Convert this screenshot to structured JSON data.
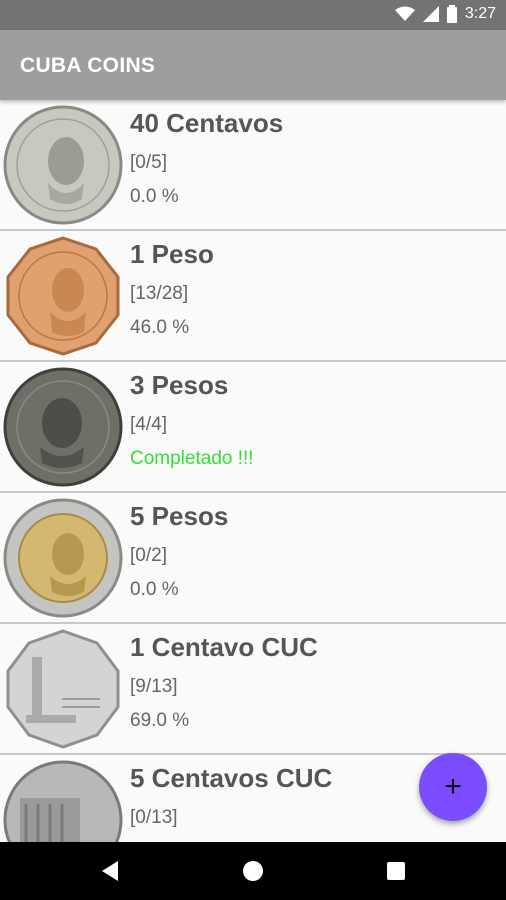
{
  "status_bar": {
    "time": "3:27",
    "icons": [
      "wifi-icon",
      "signal-icon",
      "battery-icon"
    ]
  },
  "app_bar": {
    "title": "CUBA COINS"
  },
  "coins": [
    {
      "name": "40 Centavos",
      "count": "[0/5]",
      "percent": "0.0 %",
      "completed": false,
      "coin_color": "#c8c8c0"
    },
    {
      "name": "1 Peso",
      "count": "[13/28]",
      "percent": "46.0 %",
      "completed": false,
      "coin_color": "#e0a070"
    },
    {
      "name": "3 Pesos",
      "count": "[4/4]",
      "percent": "Completado !!!",
      "completed": true,
      "coin_color": "#6e7068"
    },
    {
      "name": "5 Pesos",
      "count": "[0/2]",
      "percent": "0.0 %",
      "completed": false,
      "coin_color": "#d4b870"
    },
    {
      "name": "1 Centavo CUC",
      "count": "[9/13]",
      "percent": "69.0 %",
      "completed": false,
      "coin_color": "#d2d4d6"
    },
    {
      "name": "5 Centavos CUC",
      "count": "[0/13]",
      "percent": "",
      "completed": false,
      "coin_color": "#b8b8b8"
    }
  ],
  "fab": {
    "label": "+",
    "color": "#7c4dff"
  },
  "nav": {
    "back_icon": "back-icon",
    "home_icon": "home-icon",
    "recents_icon": "recents-icon"
  },
  "colors": {
    "status_bar": "#737373",
    "app_bar": "#9e9e9e",
    "completed_text": "#33dd33"
  }
}
